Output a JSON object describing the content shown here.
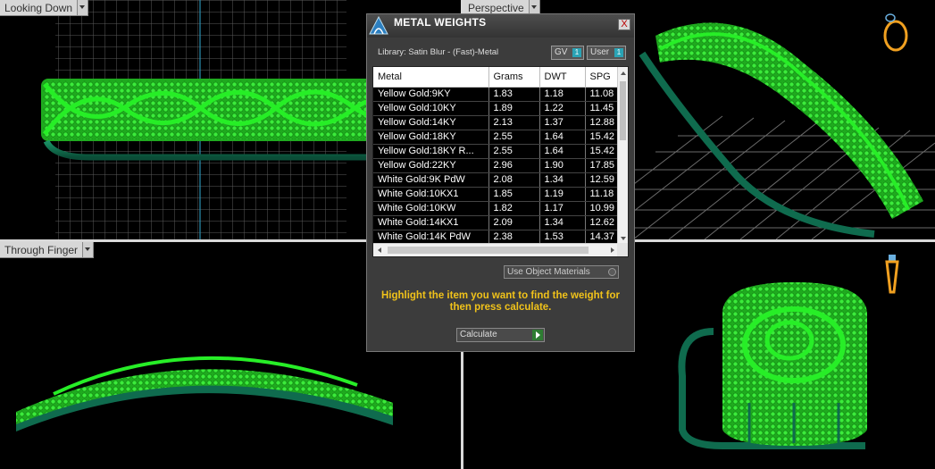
{
  "viewports": {
    "top_left": "Looking Down",
    "top_right": "Perspective",
    "bottom_left": "Through Finger",
    "bottom_right": ""
  },
  "icons": {
    "viewports_dropdown": "chevron-down-icon",
    "dialog_logo": "app-logo-icon",
    "dialog_close": "close-icon",
    "view_cube": "ring-view-icon",
    "calculate": "play-arrow-icon"
  },
  "colors": {
    "accent": "#2aa3b5",
    "hint_text": "#f0c21a",
    "model_green": "#22dd22",
    "model_shank": "#0f6b4e",
    "grid": "#5a5a5a",
    "dialog_bg": "#3c3c3c"
  },
  "dialog": {
    "title": "METAL WEIGHTS",
    "close_label": "X",
    "library": "Library: Satin Blur - (Fast)-Metal",
    "gv_label": "GV",
    "gv_value": "1",
    "user_label": "User",
    "user_value": "1",
    "use_object_materials": "Use Object Materials",
    "hint": "Highlight the item you want to find the weight for then press calculate.",
    "calculate_label": "Calculate"
  },
  "table": {
    "columns": [
      "Metal",
      "Grams",
      "DWT",
      "SPG"
    ],
    "rows": [
      [
        "Yellow Gold:9KY",
        "1.83",
        "1.18",
        "11.08"
      ],
      [
        "Yellow Gold:10KY",
        "1.89",
        "1.22",
        "11.45"
      ],
      [
        "Yellow Gold:14KY",
        "2.13",
        "1.37",
        "12.88"
      ],
      [
        "Yellow Gold:18KY",
        "2.55",
        "1.64",
        "15.42"
      ],
      [
        "Yellow Gold:18KY R...",
        "2.55",
        "1.64",
        "15.42"
      ],
      [
        "Yellow Gold:22KY",
        "2.96",
        "1.90",
        "17.85"
      ],
      [
        "White Gold:9K PdW",
        "2.08",
        "1.34",
        "12.59"
      ],
      [
        "White Gold:10KX1",
        "1.85",
        "1.19",
        "11.18"
      ],
      [
        "White Gold:10KW",
        "1.82",
        "1.17",
        "10.99"
      ],
      [
        "White Gold:14KX1",
        "2.09",
        "1.34",
        "12.62"
      ],
      [
        "White Gold:14K PdW",
        "2.38",
        "1.53",
        "14.37"
      ]
    ]
  }
}
